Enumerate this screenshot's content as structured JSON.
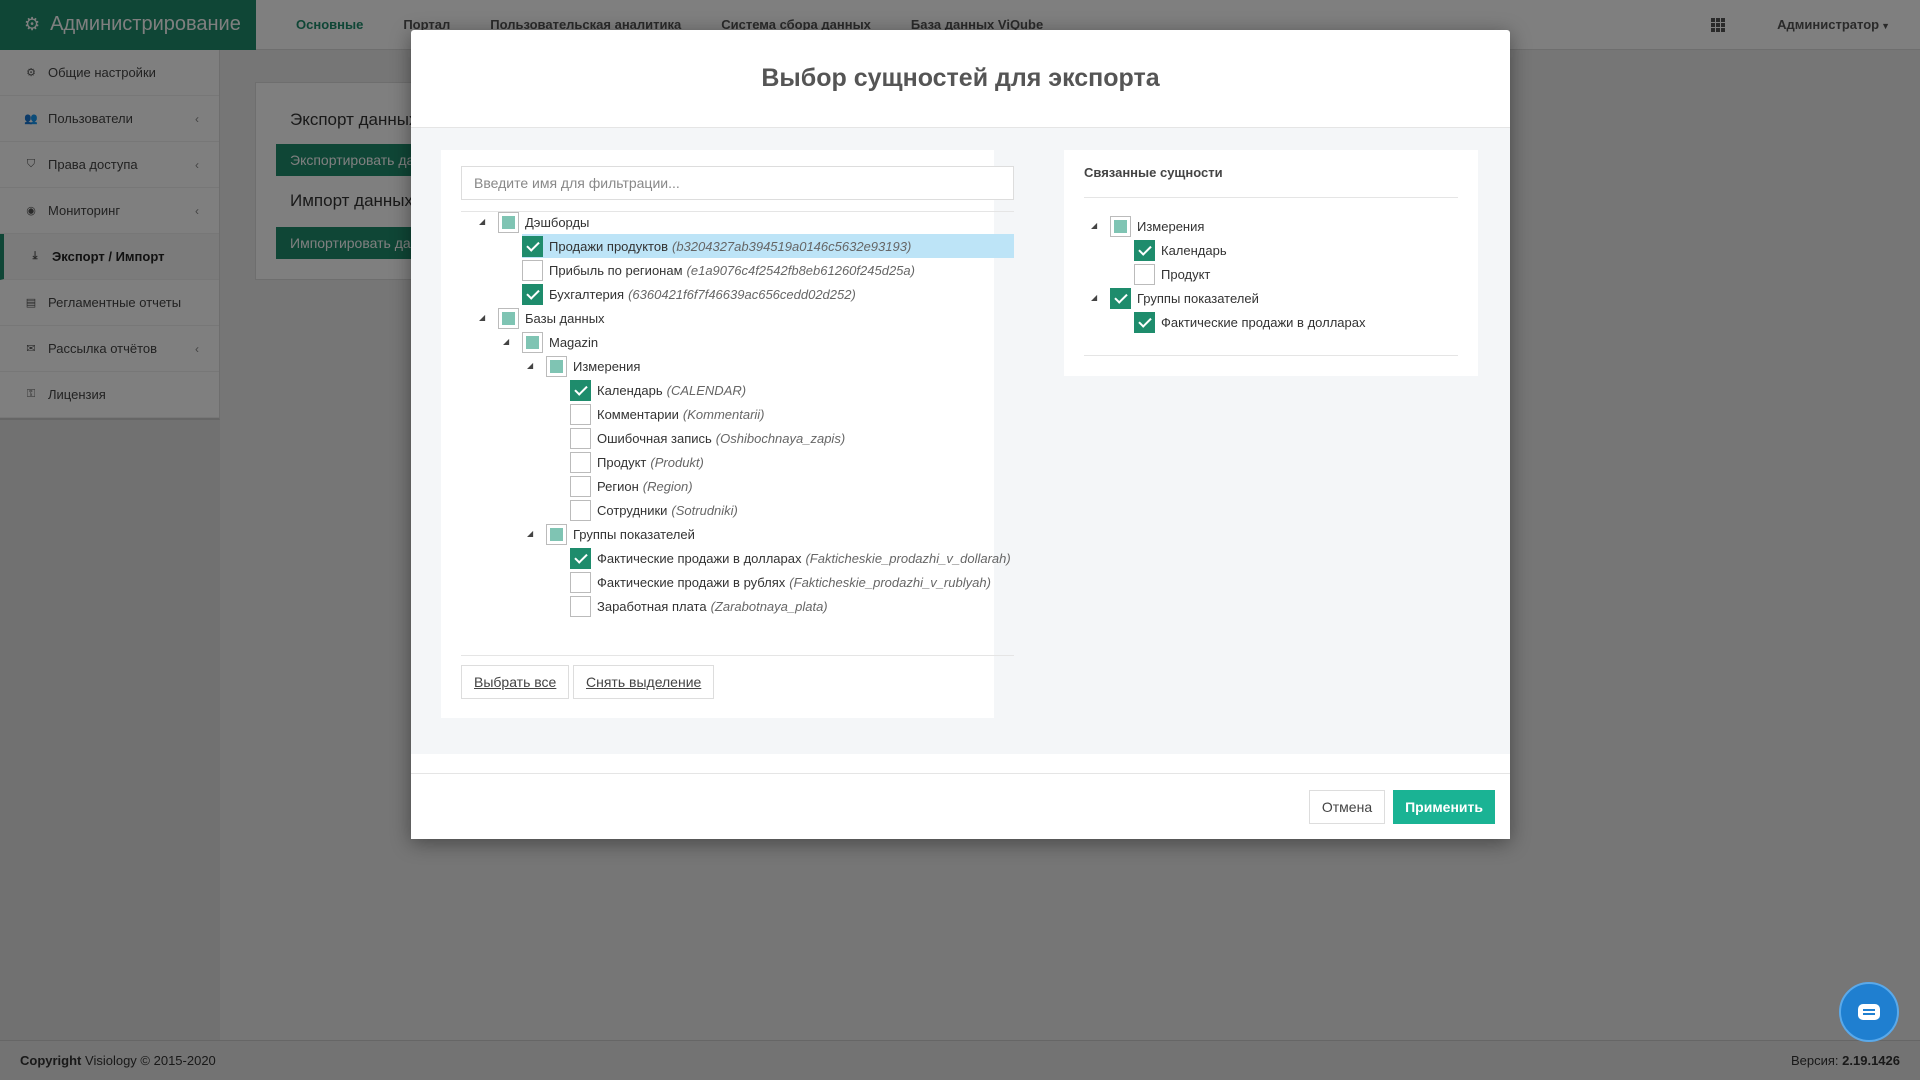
{
  "app": {
    "brand": "Администрирование"
  },
  "topnav": [
    "Основные",
    "Портал",
    "Пользовательская аналитика",
    "Система сбора данных",
    "База данных ViQube"
  ],
  "user": {
    "name": "Администратор"
  },
  "sidebar": {
    "items": [
      {
        "label": "Общие настройки",
        "icon": "gear-icon"
      },
      {
        "label": "Пользователи",
        "icon": "users-icon",
        "expandable": true
      },
      {
        "label": "Права доступа",
        "icon": "shield-icon",
        "expandable": true
      },
      {
        "label": "Мониторинг",
        "icon": "monitor-icon",
        "expandable": true
      },
      {
        "label": "Экспорт / Импорт",
        "icon": "download-icon",
        "active": true
      },
      {
        "label": "Регламентные отчеты",
        "icon": "report-icon"
      },
      {
        "label": "Рассылка отчётов",
        "icon": "mail-icon",
        "expandable": true
      },
      {
        "label": "Лицензия",
        "icon": "key-icon"
      }
    ]
  },
  "content": {
    "export_title": "Экспорт данных",
    "export_button": "Экспортировать данные",
    "import_title": "Импорт данных",
    "import_button": "Импортировать данные"
  },
  "footer": {
    "copyright_label": "Copyright",
    "copyright_text": "Visiology © 2015-2020",
    "version_label": "Версия:",
    "version_value": "2.19.1426"
  },
  "modal": {
    "title": "Выбор сущностей для экспорта",
    "filter_placeholder": "Введите имя для фильтрации...",
    "select_all": "Выбрать все",
    "clear_selection": "Снять выделение",
    "cancel": "Отмена",
    "apply": "Применить",
    "tree": [
      {
        "label": "Дэшборды",
        "code": "",
        "level": 0,
        "state": "partial",
        "toggle": true
      },
      {
        "label": "Продажи продуктов",
        "code": "(b3204327ab394519a0146c5632e93193)",
        "level": 1,
        "state": "checked",
        "selected": true
      },
      {
        "label": "Прибыль по регионам",
        "code": "(e1a9076c4f2542fb8eb61260f245d25a)",
        "level": 1,
        "state": "unchecked"
      },
      {
        "label": "Бухгалтерия",
        "code": "(6360421f6f7f46639ac656cedd02d252)",
        "level": 1,
        "state": "checked"
      },
      {
        "label": "Базы данных",
        "code": "",
        "level": 0,
        "state": "partial",
        "toggle": true
      },
      {
        "label": "Magazin",
        "code": "",
        "level": 1,
        "state": "partial",
        "toggle": true
      },
      {
        "label": "Измерения",
        "code": "",
        "level": 2,
        "state": "partial",
        "toggle": true
      },
      {
        "label": "Календарь",
        "code": "(CALENDAR)",
        "level": 3,
        "state": "checked"
      },
      {
        "label": "Комментарии",
        "code": "(Kommentarii)",
        "level": 3,
        "state": "unchecked"
      },
      {
        "label": "Ошибочная запись",
        "code": "(Oshibochnaya_zapis)",
        "level": 3,
        "state": "unchecked"
      },
      {
        "label": "Продукт",
        "code": "(Produkt)",
        "level": 3,
        "state": "unchecked"
      },
      {
        "label": "Регион",
        "code": "(Region)",
        "level": 3,
        "state": "unchecked"
      },
      {
        "label": "Сотрудники",
        "code": "(Sotrudniki)",
        "level": 3,
        "state": "unchecked"
      },
      {
        "label": "Группы показателей",
        "code": "",
        "level": 2,
        "state": "partial",
        "toggle": true
      },
      {
        "label": "Фактические продажи в долларах",
        "code": "(Fakticheskie_prodazhi_v_dollarah)",
        "level": 3,
        "state": "checked"
      },
      {
        "label": "Фактические продажи в рублях",
        "code": "(Fakticheskie_prodazhi_v_rublyah)",
        "level": 3,
        "state": "unchecked"
      },
      {
        "label": "Заработная плата",
        "code": "(Zarabotnaya_plata)",
        "level": 3,
        "state": "unchecked"
      }
    ],
    "related_title": "Связанные сущности",
    "related_tree": [
      {
        "label": "Измерения",
        "level": 0,
        "state": "partial",
        "toggle": true
      },
      {
        "label": "Календарь",
        "level": 1,
        "state": "checked"
      },
      {
        "label": "Продукт",
        "level": 1,
        "state": "unchecked"
      },
      {
        "label": "Группы показателей",
        "level": 0,
        "state": "checked",
        "toggle": true
      },
      {
        "label": "Фактические продажи в долларах",
        "level": 1,
        "state": "checked"
      }
    ]
  }
}
